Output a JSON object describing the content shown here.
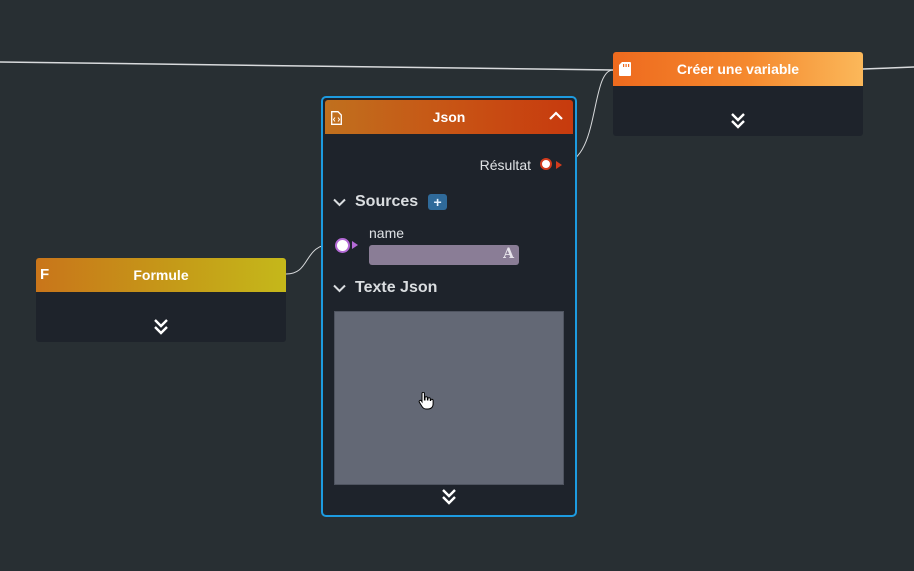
{
  "nodes": {
    "creer_variable": {
      "title": "Créer une variable"
    },
    "formule": {
      "title": "Formule",
      "icon_letter": "F"
    },
    "json": {
      "title": "Json",
      "output_label": "Résultat",
      "sources_label": "Sources",
      "add_symbol": "+",
      "field_label": "name",
      "field_type_icon": "A",
      "json_text_label": "Texte Json",
      "json_text_value": ""
    }
  },
  "colors": {
    "canvas_bg": "#282f33",
    "node_bg": "#1e232b",
    "selected_border": "#1d9be0",
    "port_output_ring": "#d23b1d",
    "port_input_ring": "#b46ad6"
  },
  "icons": [
    "file-code-icon",
    "sd-card-icon",
    "chevron-up-icon",
    "chevron-down-icon",
    "double-chevron-down-icon",
    "text-type-icon",
    "hand-cursor-icon"
  ]
}
